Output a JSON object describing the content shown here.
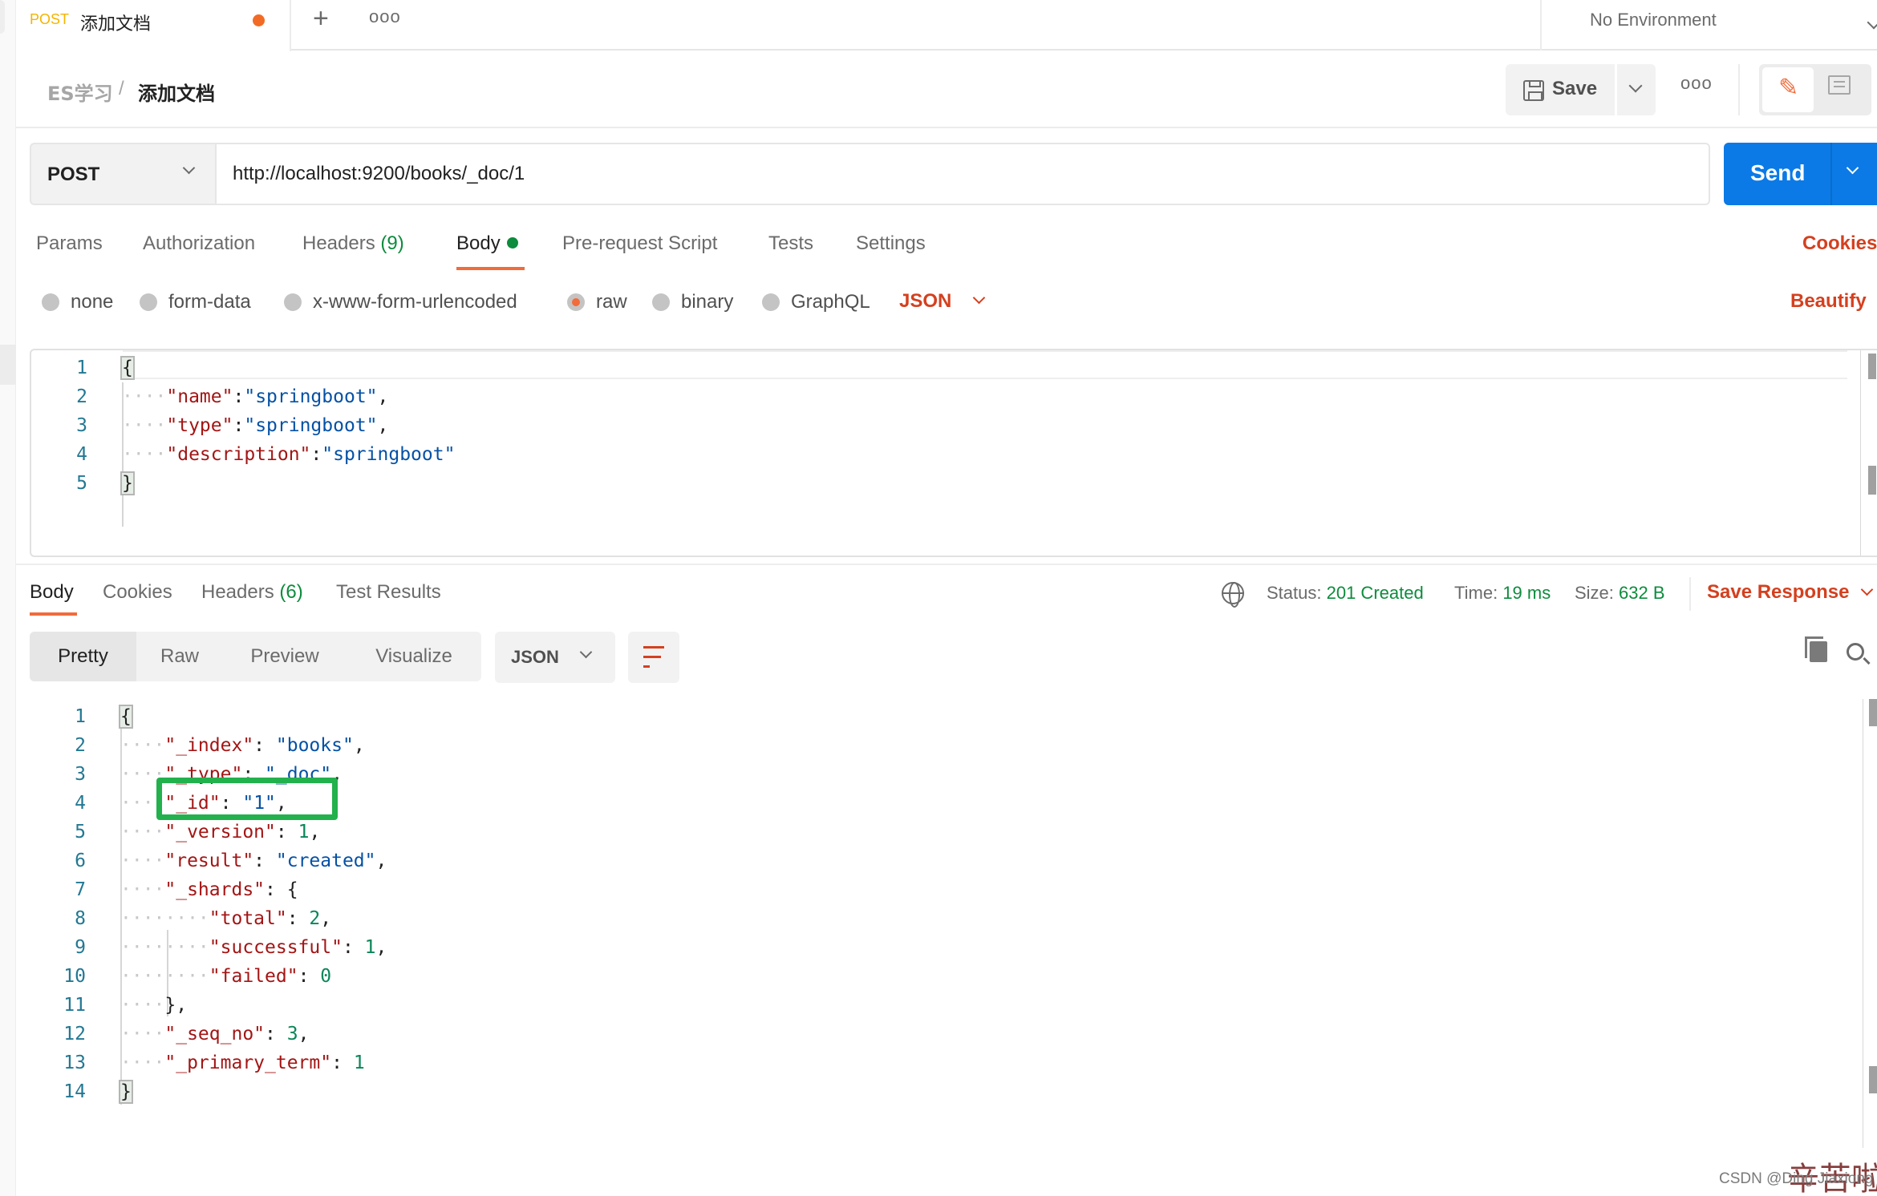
{
  "tabbar": {
    "active_tab": {
      "method": "POST",
      "title": "添加文档",
      "unsaved": true
    },
    "new_tab_icon": "+",
    "more_icon": "ooo",
    "environment": "No Environment"
  },
  "breadcrumb": {
    "parent": "ES学习",
    "separator": "/",
    "current": "添加文档"
  },
  "toolbar": {
    "save_label": "Save",
    "more_icon": "ooo"
  },
  "request": {
    "method": "POST",
    "url": "http://localhost:9200/books/_doc/1",
    "send_label": "Send",
    "tabs": [
      {
        "label": "Params"
      },
      {
        "label": "Authorization"
      },
      {
        "label": "Headers",
        "count": "(9)"
      },
      {
        "label": "Body",
        "active": true
      },
      {
        "label": "Pre-request Script"
      },
      {
        "label": "Tests"
      },
      {
        "label": "Settings"
      }
    ],
    "cookies_label": "Cookies",
    "body_types": [
      {
        "label": "none"
      },
      {
        "label": "form-data"
      },
      {
        "label": "x-www-form-urlencoded"
      },
      {
        "label": "raw",
        "selected": true
      },
      {
        "label": "binary"
      },
      {
        "label": "GraphQL"
      }
    ],
    "body_language": "JSON",
    "beautify_label": "Beautify",
    "body_lines": [
      {
        "n": "1",
        "text": "{"
      },
      {
        "n": "2",
        "key": "\"name\"",
        "sep": ":",
        "val": "\"springboot\"",
        "end": ","
      },
      {
        "n": "3",
        "key": "\"type\"",
        "sep": ":",
        "val": "\"springboot\"",
        "end": ","
      },
      {
        "n": "4",
        "key": "\"description\"",
        "sep": ":",
        "val": "\"springboot\"",
        "end": ""
      },
      {
        "n": "5",
        "text": "}"
      }
    ]
  },
  "response": {
    "tabs": [
      {
        "label": "Body",
        "active": true
      },
      {
        "label": "Cookies"
      },
      {
        "label": "Headers",
        "count": "(6)"
      },
      {
        "label": "Test Results"
      }
    ],
    "status_label": "Status:",
    "status_value": "201 Created",
    "time_label": "Time:",
    "time_value": "19 ms",
    "size_label": "Size:",
    "size_value": "632 B",
    "save_response_label": "Save Response",
    "views": [
      "Pretty",
      "Raw",
      "Preview",
      "Visualize"
    ],
    "active_view": "Pretty",
    "format": "JSON",
    "lines": [
      {
        "n": "1",
        "text": "{"
      },
      {
        "n": "2",
        "key": "\"_index\"",
        "sep": ": ",
        "sval": "\"books\"",
        "end": ","
      },
      {
        "n": "3",
        "key": "\"_type\"",
        "sep": ": ",
        "sval": "\"_doc\"",
        "end": ","
      },
      {
        "n": "4",
        "key": "\"_id\"",
        "sep": ": ",
        "sval": "\"1\"",
        "end": ","
      },
      {
        "n": "5",
        "key": "\"_version\"",
        "sep": ": ",
        "nval": "1",
        "end": ","
      },
      {
        "n": "6",
        "key": "\"result\"",
        "sep": ": ",
        "sval": "\"created\"",
        "end": ","
      },
      {
        "n": "7",
        "key": "\"_shards\"",
        "sep": ": ",
        "end": "{"
      },
      {
        "n": "8",
        "key": "\"total\"",
        "sep": ": ",
        "nval": "2",
        "end": ",",
        "nested": true
      },
      {
        "n": "9",
        "key": "\"successful\"",
        "sep": ": ",
        "nval": "1",
        "end": ",",
        "nested": true
      },
      {
        "n": "10",
        "key": "\"failed\"",
        "sep": ": ",
        "nval": "0",
        "end": "",
        "nested": true
      },
      {
        "n": "11",
        "close": "},"
      },
      {
        "n": "12",
        "key": "\"_seq_no\"",
        "sep": ": ",
        "nval": "3",
        "end": ","
      },
      {
        "n": "13",
        "key": "\"_primary_term\"",
        "sep": ": ",
        "nval": "1",
        "end": ""
      },
      {
        "n": "14",
        "text": "}"
      }
    ]
  },
  "annotation": {
    "highlighted_line": "4",
    "color": "#22b14c"
  },
  "watermark": "CSDN @Ding Jiaxiong",
  "stamp_text": "辛苦啦",
  "colors": {
    "accent_orange": "#f26b3a",
    "send_blue": "#0b7ae6",
    "success_green": "#0c8c3c",
    "link_red": "#d4401f",
    "method_yellow": "#f4b400"
  }
}
